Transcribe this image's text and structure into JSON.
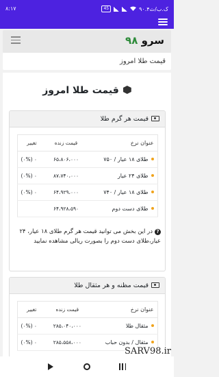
{
  "status_bar": {
    "time": "۸:۱۷",
    "speed": "۹۰.۴ک.ب/ث",
    "battery": "45"
  },
  "navbar": {
    "brand_word": "سرو",
    "brand_number": "۹۸"
  },
  "breadcrumb": "قیمت طلا امروز",
  "page_title": "قیمت طلا امروز",
  "card_gram": {
    "header": "قیمت هر گرم طلا",
    "columns": [
      "عنوان نرخ",
      "قیمت زنده",
      "تغییر"
    ],
    "rows": [
      {
        "title": "طلای ۱۸ عیار / ۷۵۰",
        "price": "۶۵،۸۰۶،۰۰۰",
        "change": "(۰%) ۰",
        "dot": true
      },
      {
        "title": "طلای ۲۴ عیار",
        "price": "۸۷،۷۴۰،۰۰۰",
        "change": "(۰%) ۰",
        "dot": true
      },
      {
        "title": "طلای ۱۸ عیار / ۷۴۰",
        "price": "۶۴،۹۲۹،۰۰۰",
        "change": "(۰%) ۰",
        "dot": true
      },
      {
        "title": "طلای دست دوم",
        "price": "۶۴،۹۲۸،۵۹۰",
        "change": "",
        "dot": true
      }
    ]
  },
  "note": "در این بخش می توانید قیمت هر گرم طلای ۱۸ عیار، ۲۴ عیار،طلای دست دوم را بصورت ریالی مشاهده نمایید",
  "card_mesghal": {
    "header": "قیمت مظنه و هر مثقال طلا",
    "columns": [
      "عنوان نرخ",
      "قیمت زنده",
      "تغییر"
    ],
    "rows": [
      {
        "title": "مثقال طلا",
        "price": "۲۸۵،۰۴۰،۰۰۰",
        "change": "(۰%) ۰",
        "dot": true
      },
      {
        "title": "مثقال / بدون حباب",
        "price": "۲۸۵،۵۵۸،۰۰۰",
        "change": "(۰%) ۰",
        "dot": true
      }
    ]
  },
  "watermark": "SARV98.ir",
  "colors": {
    "primary": "#4d22e0",
    "brand_green": "#2e8b3a",
    "dot": "#f0a31b"
  }
}
